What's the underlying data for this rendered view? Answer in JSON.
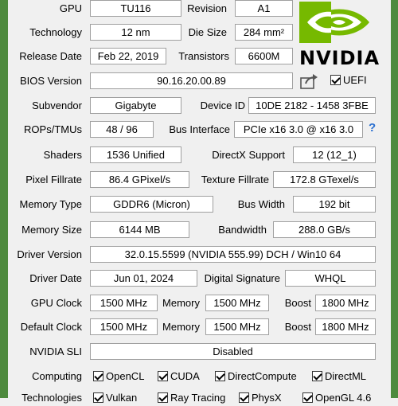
{
  "labels": {
    "gpu": "GPU",
    "revision": "Revision",
    "technology": "Technology",
    "die_size": "Die Size",
    "release_date": "Release Date",
    "transistors": "Transistors",
    "bios_version": "BIOS Version",
    "subvendor": "Subvendor",
    "device_id": "Device ID",
    "rops_tmus": "ROPs/TMUs",
    "bus_interface": "Bus Interface",
    "shaders": "Shaders",
    "directx_support": "DirectX Support",
    "pixel_fillrate": "Pixel Fillrate",
    "texture_fillrate": "Texture Fillrate",
    "memory_type": "Memory Type",
    "bus_width": "Bus Width",
    "memory_size": "Memory Size",
    "bandwidth": "Bandwidth",
    "driver_version": "Driver Version",
    "driver_date": "Driver Date",
    "digital_signature": "Digital Signature",
    "gpu_clock": "GPU Clock",
    "memory": "Memory",
    "boost": "Boost",
    "default_clock": "Default Clock",
    "nvidia_sli": "NVIDIA SLI",
    "computing": "Computing",
    "technologies": "Technologies"
  },
  "values": {
    "gpu": "TU116",
    "revision": "A1",
    "technology": "12 nm",
    "die_size": "284 mm²",
    "release_date": "Feb 22, 2019",
    "transistors": "6600M",
    "bios_version": "90.16.20.00.89",
    "subvendor": "Gigabyte",
    "device_id": "10DE 2182 - 1458 3FBE",
    "rops_tmus": "48 / 96",
    "bus_interface": "PCIe x16 3.0 @ x16 3.0",
    "shaders": "1536 Unified",
    "directx_support": "12 (12_1)",
    "pixel_fillrate": "86.4 GPixel/s",
    "texture_fillrate": "172.8 GTexel/s",
    "memory_type": "GDDR6 (Micron)",
    "bus_width": "192 bit",
    "memory_size": "6144 MB",
    "bandwidth": "288.0 GB/s",
    "driver_version": "32.0.15.5599 (NVIDIA 555.99) DCH / Win10 64",
    "driver_date": "Jun 01, 2024",
    "digital_signature": "WHQL",
    "gpu_clock": "1500 MHz",
    "gpu_memory": "1500 MHz",
    "gpu_boost": "1800 MHz",
    "default_clock": "1500 MHz",
    "default_memory": "1500 MHz",
    "default_boost": "1800 MHz",
    "nvidia_sli": "Disabled"
  },
  "uefi": {
    "label": "UEFI",
    "checked": true
  },
  "computing": [
    {
      "label": "OpenCL",
      "checked": true
    },
    {
      "label": "CUDA",
      "checked": true
    },
    {
      "label": "DirectCompute",
      "checked": true
    },
    {
      "label": "DirectML",
      "checked": true
    }
  ],
  "technologies": [
    {
      "label": "Vulkan",
      "checked": true
    },
    {
      "label": "Ray Tracing",
      "checked": true
    },
    {
      "label": "PhysX",
      "checked": true
    },
    {
      "label": "OpenGL 4.6",
      "checked": true
    }
  ],
  "logo": {
    "brand": "NVIDIA",
    "color": "#76b900",
    "icon": "nvidia-eye-icon"
  },
  "icons": {
    "share": "share-icon",
    "help": "help-icon"
  },
  "colors": {
    "accent": "#4e8a3e",
    "field_bg": "#ffffff",
    "window_bg": "#f0f0f0"
  }
}
